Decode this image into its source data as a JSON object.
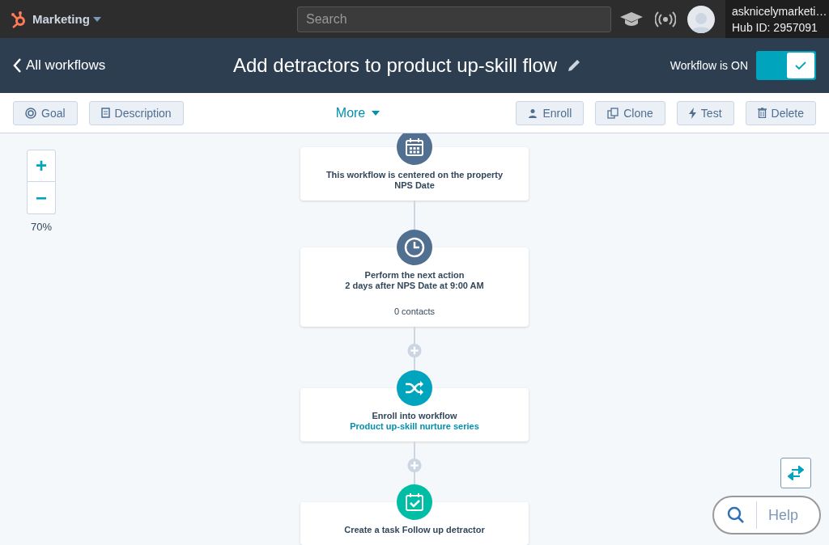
{
  "topbar": {
    "app_menu": "Marketing",
    "search": {
      "placeholder": "Search"
    },
    "account": {
      "name": "asknicelymarketi…",
      "hub_id": "Hub ID: 2957091"
    }
  },
  "header": {
    "back_link": "All workflows",
    "title": "Add detractors to product up-skill flow",
    "toggle": {
      "label": "Workflow is ON",
      "on": true
    }
  },
  "toolbar": {
    "left_buttons": [
      {
        "kind": "goal",
        "label": "Goal"
      },
      {
        "kind": "description",
        "label": "Description"
      }
    ],
    "more": "More",
    "right_buttons": [
      {
        "kind": "enroll",
        "label": "Enroll"
      },
      {
        "kind": "clone",
        "label": "Clone"
      },
      {
        "kind": "test",
        "label": "Test"
      },
      {
        "kind": "delete",
        "label": "Delete"
      }
    ]
  },
  "zoom": {
    "zoom_in": "+",
    "zoom_out": "−",
    "level_text": "70%"
  },
  "steps": [
    {
      "kind": "calendar",
      "lines": [
        "This workflow is centered on the property",
        "NPS Date"
      ]
    },
    {
      "kind": "clock",
      "lines": [
        "Perform the next action",
        "2 days after NPS Date at 9:00 AM"
      ],
      "count": "0 contacts"
    },
    {
      "kind": "shuffle",
      "text": "Enroll into workflow",
      "link": "Product up-skill nurture series"
    },
    {
      "kind": "task",
      "lines": [
        "Create a task Follow up detractor"
      ]
    }
  ],
  "help": {
    "label": "Help"
  }
}
